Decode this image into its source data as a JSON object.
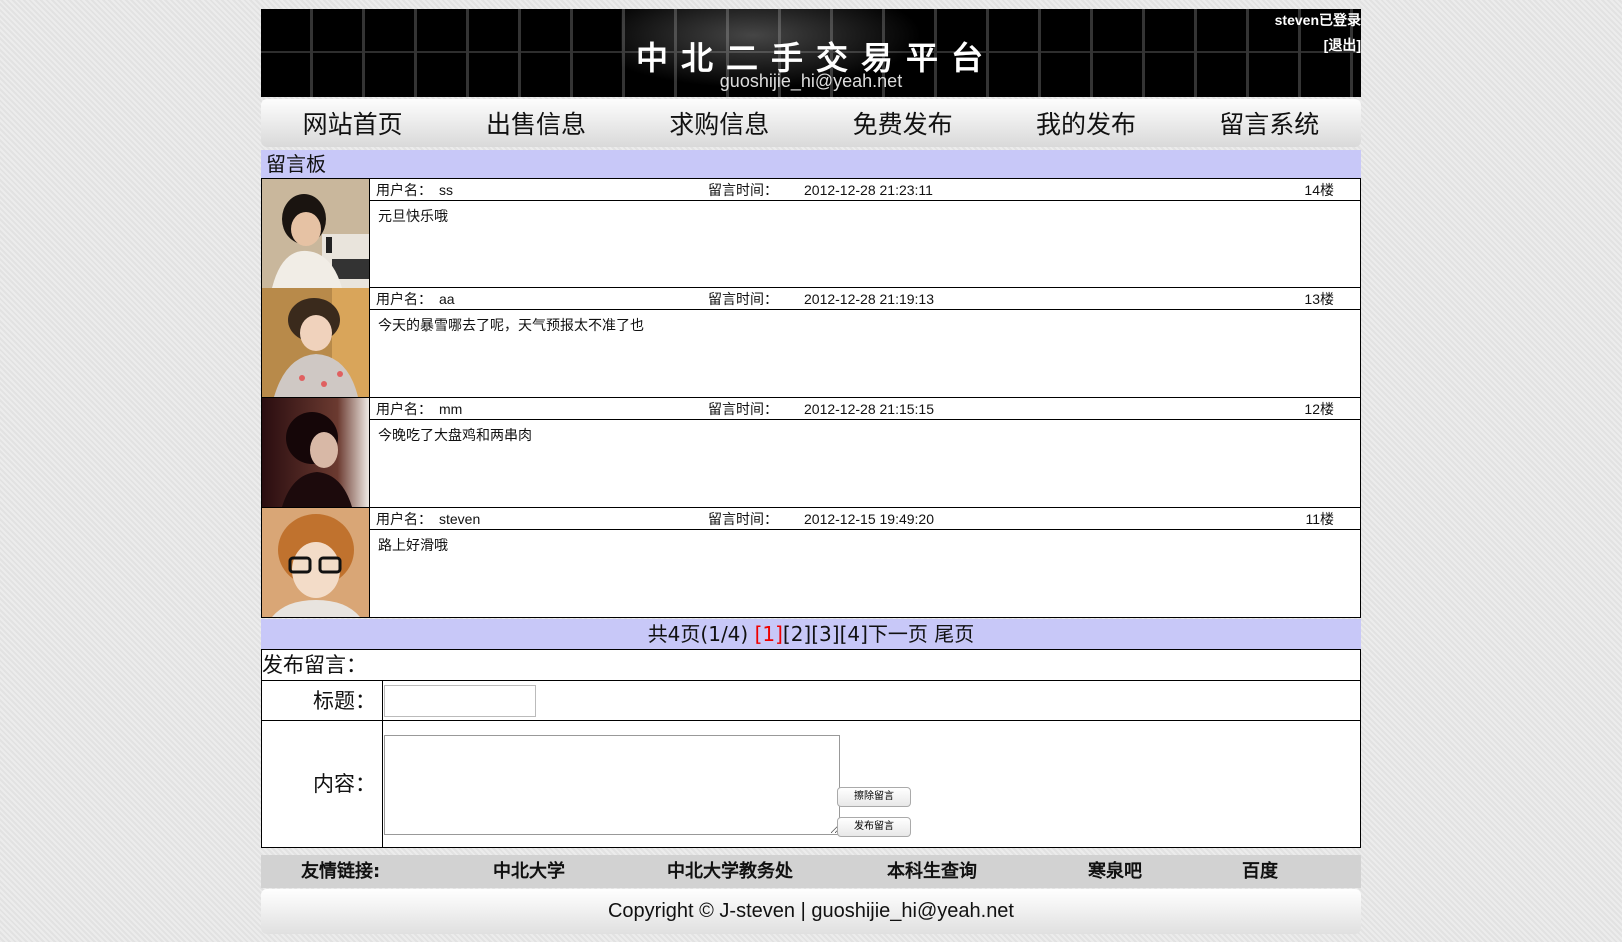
{
  "header": {
    "site_title": "中北二手交易平台",
    "site_email": "guoshijie_hi@yeah.net",
    "login_user": "steven已登录",
    "logout_label": "[退出]"
  },
  "nav": {
    "items": [
      {
        "label": "网站首页"
      },
      {
        "label": "出售信息"
      },
      {
        "label": "求购信息"
      },
      {
        "label": "免费发布"
      },
      {
        "label": "我的发布"
      },
      {
        "label": "留言系统"
      }
    ]
  },
  "board": {
    "title": "留言板",
    "user_label": "用户名：",
    "time_label": "留言时间：",
    "messages": [
      {
        "user": "ss",
        "time": "2012-12-28 21:23:11",
        "floor": "14楼",
        "content": "元旦快乐哦"
      },
      {
        "user": "aa",
        "time": "2012-12-28 21:19:13",
        "floor": "13楼",
        "content": "今天的暴雪哪去了呢，天气预报太不准了也"
      },
      {
        "user": "mm",
        "time": "2012-12-28 21:15:15",
        "floor": "12楼",
        "content": "今晚吃了大盘鸡和两串肉"
      },
      {
        "user": "steven",
        "time": "2012-12-15 19:49:20",
        "floor": "11楼",
        "content": "路上好滑哦"
      }
    ]
  },
  "pager": {
    "summary": "共4页(1/4) ",
    "current": "[1]",
    "pages": [
      "[2]",
      "[3]",
      "[4]"
    ],
    "next": "下一页",
    "last": "尾页"
  },
  "form": {
    "heading": "发布留言：",
    "title_label": "标题：",
    "content_label": "内容：",
    "clear_button": "擦除留言",
    "submit_button": "发布留言"
  },
  "links": {
    "label": "友情链接:",
    "items": [
      "中北大学",
      "中北大学教务处",
      "本科生查询",
      "寒泉吧",
      "百度"
    ]
  },
  "footer": {
    "copyright": "Copyright © J-steven | guoshijie_hi@yeah.net"
  }
}
